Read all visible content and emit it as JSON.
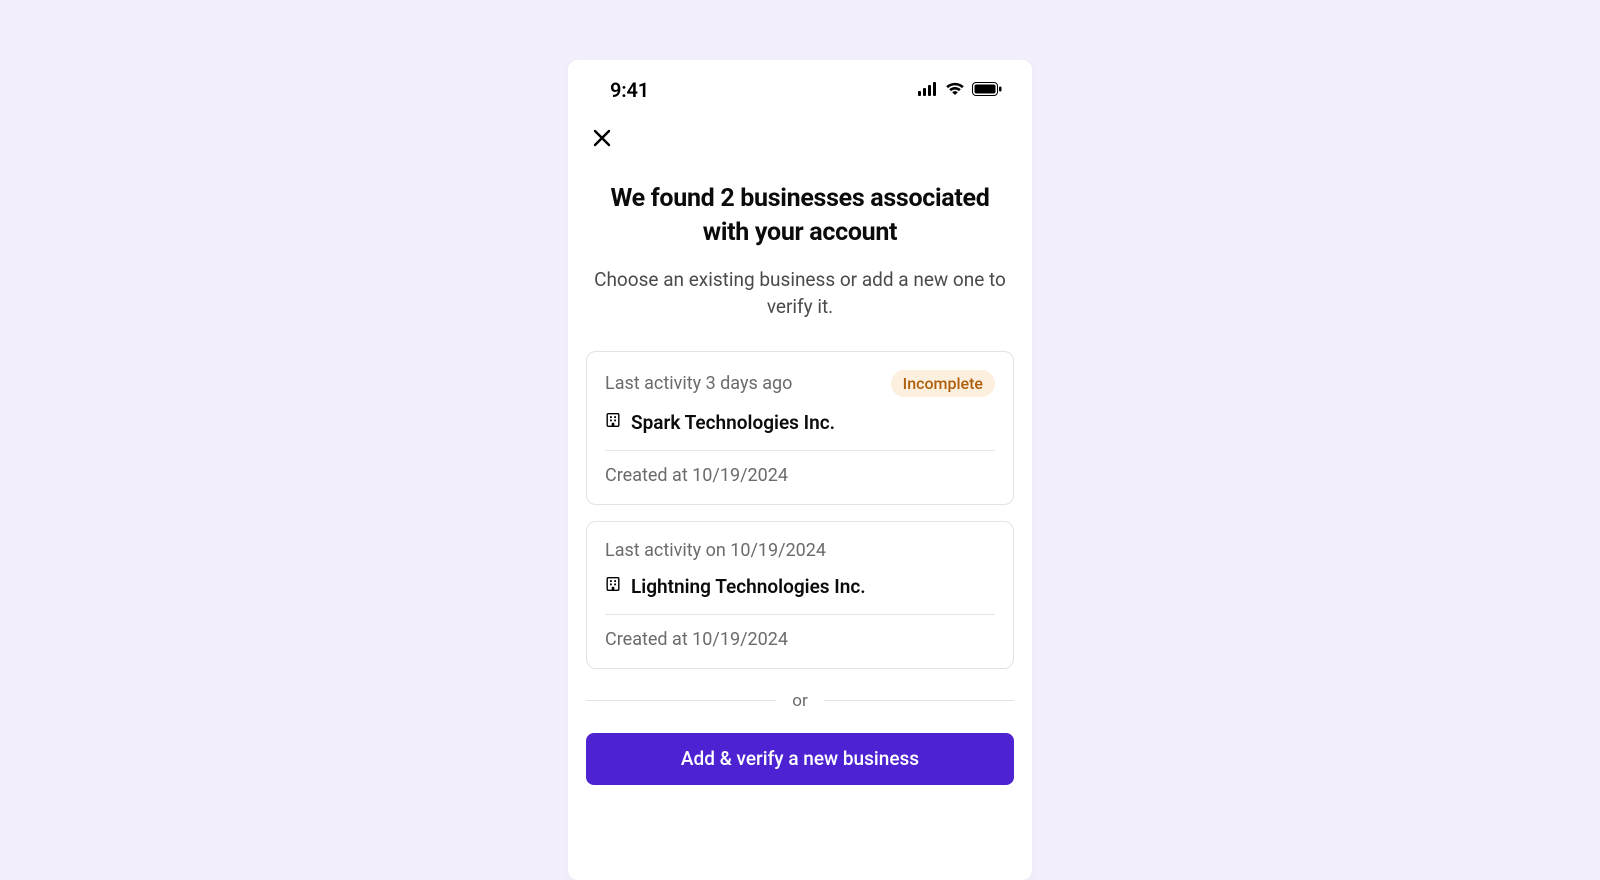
{
  "status": {
    "time": "9:41"
  },
  "header": {
    "title": "We found 2 businesses associated with your account",
    "subtitle": "Choose an existing business or add a new one to verify it."
  },
  "businesses": [
    {
      "activity": "Last activity 3 days ago",
      "badge": "Incomplete",
      "name": "Spark Technologies Inc.",
      "created": "Created at 10/19/2024"
    },
    {
      "activity": "Last activity on 10/19/2024",
      "badge": "",
      "name": "Lightning Technologies Inc.",
      "created": "Created at 10/19/2024"
    }
  ],
  "or_label": "or",
  "cta_label": "Add & verify a new business"
}
